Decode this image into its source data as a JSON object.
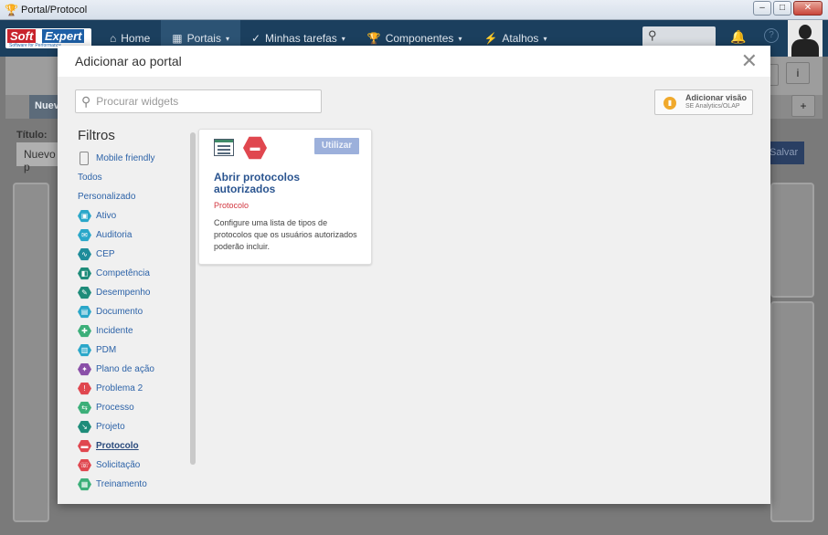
{
  "window": {
    "title": "Portal/Protocol"
  },
  "navbar": {
    "logo": {
      "soft": "Soft",
      "expert": "Expert",
      "tagline": "Software for Performance"
    },
    "items": [
      {
        "label": "Home",
        "icon": "home-icon",
        "glyph": "⌂"
      },
      {
        "label": "Portais",
        "icon": "portal-icon",
        "glyph": "▦",
        "dropdown": true
      },
      {
        "label": "Minhas tarefas",
        "icon": "check-icon",
        "glyph": "✓",
        "dropdown": true
      },
      {
        "label": "Componentes",
        "icon": "trophy-icon",
        "glyph": "🏆",
        "dropdown": true
      },
      {
        "label": "Atalhos",
        "icon": "bolt-icon",
        "glyph": "⚡",
        "dropdown": true
      }
    ]
  },
  "background": {
    "tab_label": "Nuev",
    "title_label": "Título:",
    "title_value": "Nuevo p",
    "save_label": "Salvar",
    "add_glyph": "+",
    "info_glyph": "i"
  },
  "modal": {
    "title": "Adicionar ao portal",
    "close_glyph": "✕",
    "search_placeholder": "Procurar widgets",
    "olap_button": {
      "line1": "Adicionar visão",
      "line2": "SE Analytics/OLAP"
    },
    "filters_heading": "Filtros",
    "filters": [
      {
        "label": "Mobile friendly",
        "kind": "mobile"
      },
      {
        "label": "Todos",
        "kind": "plain"
      },
      {
        "label": "Personalizado",
        "kind": "plain"
      },
      {
        "label": "Ativo",
        "color": "#2aa7c9",
        "glyph": "▣"
      },
      {
        "label": "Auditoria",
        "color": "#2aa7c9",
        "glyph": "✉"
      },
      {
        "label": "CEP",
        "color": "#1e8c9a",
        "glyph": "∿"
      },
      {
        "label": "Competência",
        "color": "#1e8c7a",
        "glyph": "◧"
      },
      {
        "label": "Desempenho",
        "color": "#1e8c7a",
        "glyph": "✎"
      },
      {
        "label": "Documento",
        "color": "#2aa7c9",
        "glyph": "▤"
      },
      {
        "label": "Incidente",
        "color": "#3caf79",
        "glyph": "✚"
      },
      {
        "label": "PDM",
        "color": "#2aa7c9",
        "glyph": "▥"
      },
      {
        "label": "Plano de ação",
        "color": "#8a4fa8",
        "glyph": "✦"
      },
      {
        "label": "Problema 2",
        "color": "#e0474f",
        "glyph": "!"
      },
      {
        "label": "Processo",
        "color": "#3caf79",
        "glyph": "⇆"
      },
      {
        "label": "Projeto",
        "color": "#1e8c7a",
        "glyph": "↘"
      },
      {
        "label": "Protocolo",
        "color": "#e0474f",
        "glyph": "▬",
        "selected": true
      },
      {
        "label": "Solicitação",
        "color": "#e0474f",
        "glyph": "☏"
      },
      {
        "label": "Treinamento",
        "color": "#3caf79",
        "glyph": "▦"
      }
    ],
    "widget": {
      "use_label": "Utilizar",
      "title": "Abrir protocolos autorizados",
      "category": "Protocolo",
      "description": "Configure uma lista de tipos de protocolos que os usuários autorizados poderão incluir."
    }
  },
  "colors": {
    "nav_bg": "#1b3f5e",
    "link": "#2d63a8",
    "widget_title": "#2b5590",
    "category": "#d2363f",
    "use_button": "#9cb0db"
  }
}
